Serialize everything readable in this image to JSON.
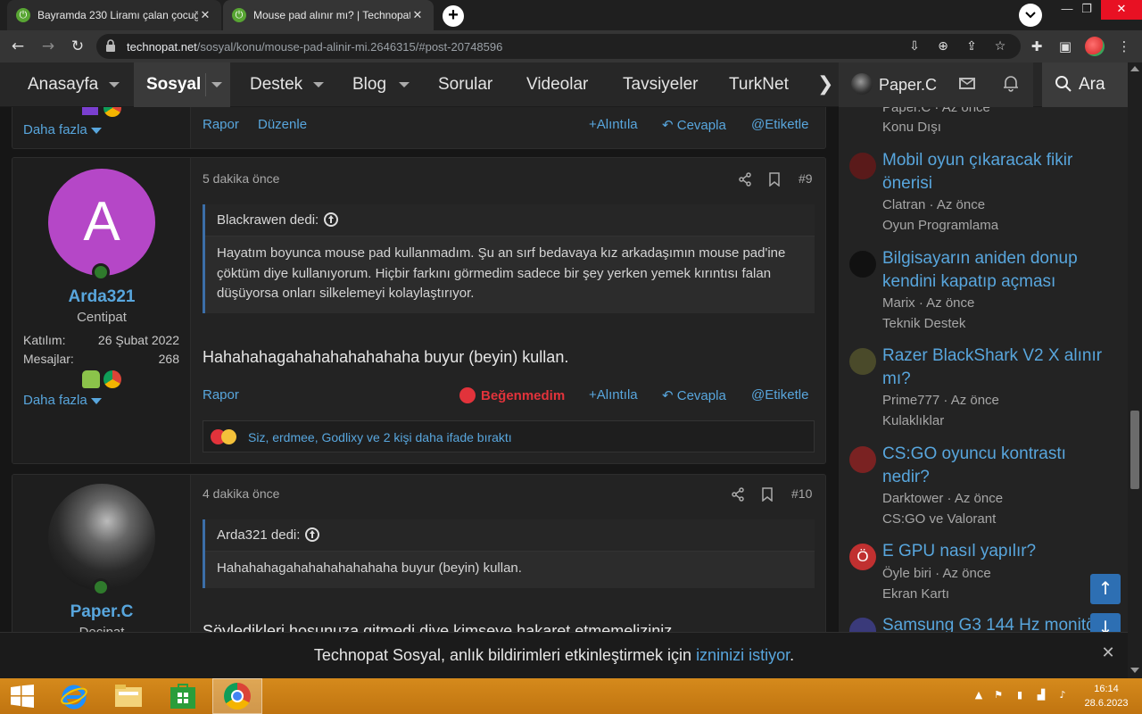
{
  "browser": {
    "tabs": [
      {
        "title": "Bayramda 230 Liramı çalan çocuğ"
      },
      {
        "title": "Mouse pad alınır mı? | Technopat"
      }
    ],
    "close_glyph": "✕",
    "new_tab_glyph": "+",
    "url_host": "technopat.net",
    "url_path": "/sosyal/konu/mouse-pad-alinir-mi.2646315/#post-20748596",
    "window_controls": [
      "—",
      "❐",
      "✕"
    ]
  },
  "site_nav": {
    "items": [
      "Anasayfa",
      "Sosyal",
      "Destek",
      "Blog",
      "Sorular",
      "Videolar",
      "Tavsiyeler",
      "TurkNet"
    ],
    "username": "Paper.C",
    "search_label": "Ara"
  },
  "post_top": {
    "more_label": "Daha fazla",
    "actions": {
      "report": "Rapor",
      "edit": "Düzenle",
      "quote": "+Alıntıla",
      "reply": "Cevapla",
      "tag": "Etiketle"
    }
  },
  "post9": {
    "avatar_letter": "A",
    "username": "Arda321",
    "user_title": "Centipat",
    "joined_label": "Katılım:",
    "joined_value": "26 Şubat 2022",
    "messages_label": "Mesajlar:",
    "messages_value": "268",
    "more_label": "Daha fazla",
    "time": "5 dakika önce",
    "number": "#9",
    "quote_author": "Blackrawen dedi:",
    "quote_text": "Hayatım boyunca mouse pad kullanmadım. Şu an sırf bedavaya kız arkadaşımın mouse pad'ine çöktüm diye kullanıyorum. Hiçbir farkını görmedim sadece bir şey yerken yemek kırıntısı falan düşüyorsa onları silkelemeyi kolaylaştırıyor.",
    "message": "Hahahahagahahahahahahaha buyur (beyin) kullan.",
    "report": "Rapor",
    "dislike": "Beğenmedim",
    "quote": "+Alıntıla",
    "reply": "Cevapla",
    "tag": "Etiketle",
    "reactions": "Siz, erdmee, Godlixy ve 2 kişi daha ifade bıraktı"
  },
  "post10": {
    "username": "Paper.C",
    "user_title": "Decipat",
    "time": "4 dakika önce",
    "number": "#10",
    "quote_author": "Arda321 dedi:",
    "quote_text": "Hahahahagahahahahahahaha buyur (beyin) kullan.",
    "message": "Söyledikleri hoşunuza gitmedi diye kimseye hakaret etmemeliziniz."
  },
  "sidebar": {
    "top": {
      "meta": "Paper.C · Az önce",
      "forum": "Konu Dışı"
    },
    "threads": [
      {
        "title": "Mobil oyun çıkaracak fikir önerisi",
        "meta": "Clatran · Az önce",
        "forum": "Oyun Programlama",
        "color": "#5a1a1a"
      },
      {
        "title": "Bilgisayarın aniden donup kendini kapatıp açması",
        "meta": "Marix · Az önce",
        "forum": "Teknik Destek",
        "color": "#111111"
      },
      {
        "title": "Razer BlackShark V2 X alınır mı?",
        "meta": "Prime777 · Az önce",
        "forum": "Kulaklıklar",
        "color": "#4a4a2a"
      },
      {
        "title": "CS:GO oyuncu kontrastı nedir?",
        "meta": "Darktower · Az önce",
        "forum": "CS:GO ve Valorant",
        "color": "#7a2222"
      },
      {
        "title": "E GPU nasıl yapılır?",
        "meta": "Öyle biri · Az önce",
        "forum": "Ekran Kartı",
        "color": "#c03030",
        "glyph": "Ö"
      },
      {
        "title": "Samsung G3 144 Hz monitör",
        "meta": "",
        "forum": "",
        "color": "#3a3a7a"
      }
    ]
  },
  "scroll": {
    "up": "↑",
    "down": "↓"
  },
  "notification": {
    "text_before": "Technopat Sosyal, anlık bildirimleri etkinleştirmek için ",
    "link": "izninizi istiyor",
    "text_after": ".",
    "close": "✕"
  },
  "taskbar": {
    "time": "16:14",
    "date": "28.6.2023"
  }
}
